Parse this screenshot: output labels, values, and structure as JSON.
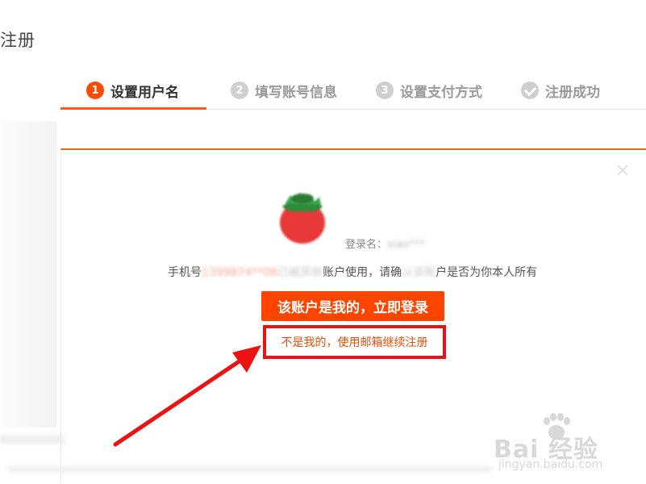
{
  "header": {
    "title": "注册"
  },
  "steps": [
    {
      "num": "1",
      "label": "设置用户名",
      "state": "active"
    },
    {
      "num": "2",
      "label": "填写账号信息",
      "state": "pending"
    },
    {
      "num": "3",
      "label": "设置支付方式",
      "state": "pending"
    },
    {
      "num": "",
      "label": "注册成功",
      "state": "pending"
    }
  ],
  "dialog": {
    "login_name_label": "登录名：",
    "login_name_value": "xiao***",
    "info_prefix": "手机号",
    "phone_masked": "1399874**08",
    "info_mid1": "已被其",
    "info_mid1_blur": "他",
    "info_mid2": "账户使用，请确",
    "info_mid2_blur": "认该账",
    "info_suffix": "户是否为你本人所有",
    "primary_button_label": "该账户是我的，立即登录",
    "email_link_label": "不是我的，使用邮箱继续注册"
  },
  "watermark": {
    "brand": "Bai  经验",
    "brand_du": "du",
    "url": "jingyan.baidu.com"
  },
  "colors": {
    "accent": "#ff4400",
    "step_active": "#ff4a00",
    "highlight_box": "#ee1111",
    "arrow": "#ee1111",
    "link": "#e8500a"
  }
}
